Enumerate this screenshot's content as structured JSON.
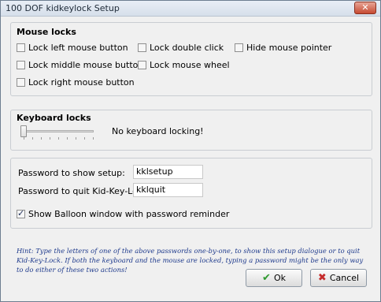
{
  "window": {
    "title": "100 DOF kidkeylock Setup",
    "close_icon": "close-icon"
  },
  "mouse_locks": {
    "title": "Mouse locks",
    "options": [
      {
        "label": "Lock left mouse button",
        "checked": false
      },
      {
        "label": "Lock double click",
        "checked": false
      },
      {
        "label": "Hide mouse pointer",
        "checked": false
      },
      {
        "label": "Lock middle mouse button",
        "checked": false
      },
      {
        "label": "Lock mouse wheel",
        "checked": false
      },
      {
        "label": "Lock right mouse button",
        "checked": false
      }
    ]
  },
  "keyboard_locks": {
    "title": "Keyboard locks",
    "slider_level": 0,
    "status": "No keyboard locking!"
  },
  "passwords": {
    "setup_label": "Password to show setup:",
    "setup_value": "kklsetup",
    "quit_label": "Password to quit Kid-Key-Lock:",
    "quit_value": "kklquit",
    "balloon_label": "Show Balloon window with password reminder",
    "balloon_checked": true
  },
  "hint": "Hint: Type the letters of one of the above passwords one-by-one, to show this setup dialogue or to quit Kid-Key-Lock. If both the keyboard and the mouse are locked, typing a password might be the only way to do either of these two actions!",
  "buttons": {
    "ok": "Ok",
    "cancel": "Cancel"
  },
  "colors": {
    "hint_text": "#1e3a8c",
    "ok_icon": "#2f9a2f",
    "cancel_icon": "#c52a2a"
  }
}
